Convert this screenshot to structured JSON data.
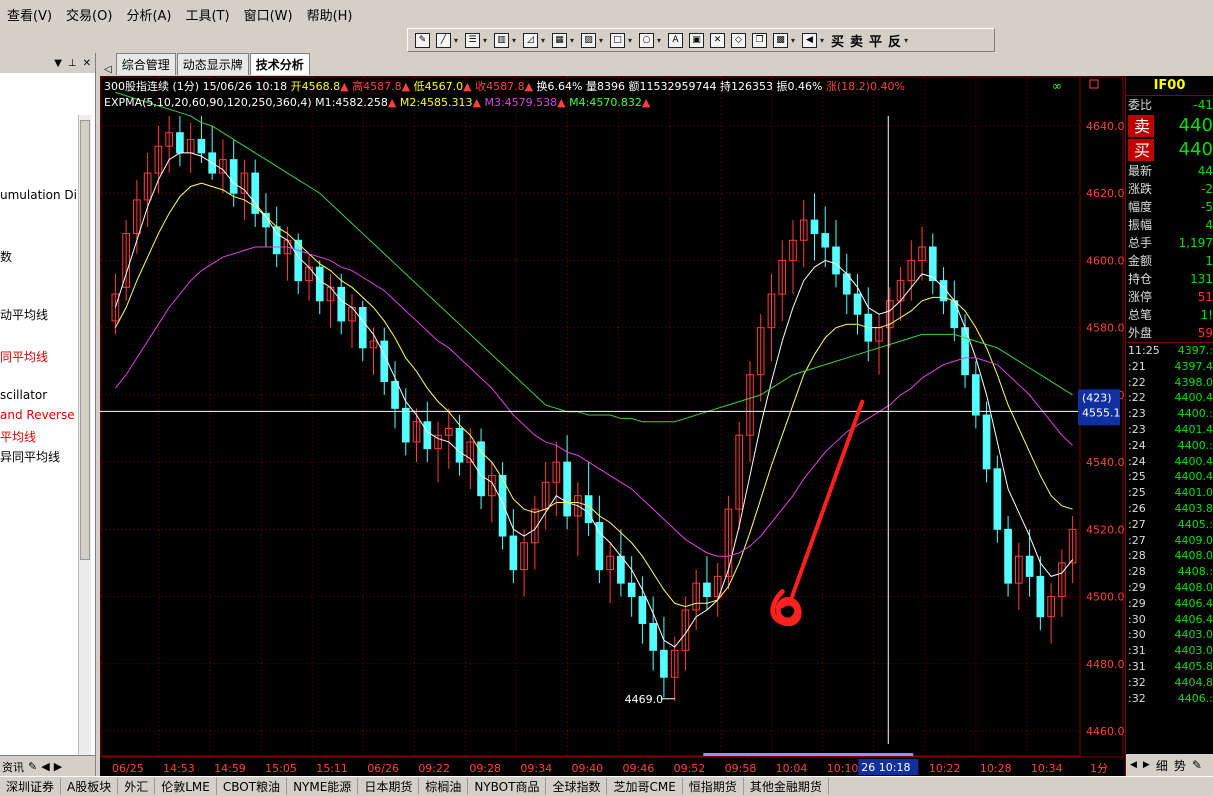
{
  "menu": [
    "查看(V)",
    "交易(O)",
    "分析(A)",
    "工具(T)",
    "窗口(W)",
    "帮助(H)"
  ],
  "toolbar": {
    "trade_buttons": [
      "买",
      "卖",
      "平",
      "反"
    ]
  },
  "left_panel": {
    "items": [
      {
        "label": "umulation Di",
        "color": "#000000"
      },
      {
        "label": "数",
        "color": "#000000"
      },
      {
        "label": "动平均线",
        "color": "#000000"
      },
      {
        "label": "同平均线",
        "color": "#e00000"
      },
      {
        "label": "scillator",
        "color": "#000000"
      },
      {
        "label": "and Reverse",
        "color": "#e00000"
      },
      {
        "label": "平均线",
        "color": "#e00000"
      },
      {
        "label": "异同平均线",
        "color": "#000000"
      }
    ],
    "footer": "资讯"
  },
  "tabs": [
    "综合管理",
    "动态显示牌",
    "技术分析"
  ],
  "chart": {
    "header": [
      {
        "text": "300股指连续 (1分)  15/06/26 10:18 ",
        "color": "#ffffff"
      },
      {
        "text": "开4568.8",
        "color": "#ffff00"
      },
      {
        "text": "▲ ",
        "color": "#ff4040"
      },
      {
        "text": "高4587.8",
        "color": "#ff4040"
      },
      {
        "text": "▲ ",
        "color": "#ff4040"
      },
      {
        "text": "低4567.0",
        "color": "#ffff00"
      },
      {
        "text": "▲ ",
        "color": "#ff4040"
      },
      {
        "text": "收4587.8",
        "color": "#ff4040"
      },
      {
        "text": "▲ ",
        "color": "#ff4040"
      },
      {
        "text": "换6.64% 量8396 额11532959744 持126353 振0.46% ",
        "color": "#ffffff"
      },
      {
        "text": "涨(18.2)0.40%",
        "color": "#ff4040"
      }
    ],
    "indicator": [
      {
        "text": "EXPMA(5,10,20,60,90,120,250,360,4) ",
        "color": "#ffffff"
      },
      {
        "text": "M1:4582.258",
        "color": "#ffffff"
      },
      {
        "text": "▲ ",
        "color": "#ff4040"
      },
      {
        "text": "M2:4585.313",
        "color": "#ffff00"
      },
      {
        "text": "▲ ",
        "color": "#ff4040"
      },
      {
        "text": "M3:4579.538",
        "color": "#e040e0"
      },
      {
        "text": "▲ ",
        "color": "#ff4040"
      },
      {
        "text": "M4:4570.832",
        "color": "#40ff40"
      },
      {
        "text": "▲",
        "color": "#ff4040"
      }
    ],
    "y_ticks": [
      "4640.0",
      "4620.0",
      "4600.0",
      "4580.0",
      "4560.0",
      "4540.0",
      "4520.0",
      "4500.0",
      "4480.0",
      "4460.0"
    ],
    "y_values": [
      4640,
      4620,
      4600,
      4580,
      4560,
      4540,
      4520,
      4500,
      4480,
      4460
    ],
    "x_labels": [
      "06/25",
      "14:53",
      "14:59",
      "15:05",
      "15:11",
      "06/26",
      "09:22",
      "09:28",
      "09:34",
      "09:40",
      "09:46",
      "09:52",
      "09:58",
      "10:04",
      "10:10",
      "10:16",
      "10:22",
      "10:28",
      "10:34"
    ],
    "crosshair_price": "4555.1",
    "crosshair_count": "(423)",
    "crosshair_time": "26 10:18",
    "low_label": "4469.0",
    "period_label": "1分"
  },
  "chart_data": {
    "type": "candlestick",
    "ylim": [
      4454,
      4644
    ],
    "grid": true,
    "ohlc": [
      [
        4582,
        4596,
        4578,
        4590
      ],
      [
        4592,
        4612,
        4588,
        4608
      ],
      [
        4608,
        4624,
        4602,
        4618
      ],
      [
        4618,
        4632,
        4610,
        4626
      ],
      [
        4626,
        4640,
        4620,
        4634
      ],
      [
        4634,
        4643,
        4626,
        4638
      ],
      [
        4638,
        4643,
        4628,
        4632
      ],
      [
        4632,
        4641,
        4626,
        4636
      ],
      [
        4636,
        4643,
        4629,
        4632
      ],
      [
        4632,
        4640,
        4624,
        4626
      ],
      [
        4626,
        4636,
        4620,
        4630
      ],
      [
        4630,
        4636,
        4616,
        4620
      ],
      [
        4620,
        4630,
        4612,
        4626
      ],
      [
        4626,
        4630,
        4610,
        4614
      ],
      [
        4614,
        4620,
        4604,
        4610
      ],
      [
        4610,
        4616,
        4598,
        4602
      ],
      [
        4602,
        4610,
        4594,
        4606
      ],
      [
        4606,
        4608,
        4590,
        4594
      ],
      [
        4594,
        4602,
        4588,
        4598
      ],
      [
        4598,
        4600,
        4584,
        4588
      ],
      [
        4588,
        4596,
        4580,
        4592
      ],
      [
        4592,
        4596,
        4578,
        4582
      ],
      [
        4582,
        4590,
        4574,
        4586
      ],
      [
        4586,
        4588,
        4570,
        4574
      ],
      [
        4574,
        4580,
        4566,
        4576
      ],
      [
        4576,
        4580,
        4560,
        4564
      ],
      [
        4564,
        4570,
        4550,
        4556
      ],
      [
        4556,
        4562,
        4542,
        4546
      ],
      [
        4546,
        4556,
        4540,
        4552
      ],
      [
        4552,
        4558,
        4540,
        4544
      ],
      [
        4544,
        4552,
        4534,
        4548
      ],
      [
        4548,
        4556,
        4538,
        4550
      ],
      [
        4550,
        4554,
        4536,
        4540
      ],
      [
        4540,
        4550,
        4532,
        4546
      ],
      [
        4546,
        4550,
        4526,
        4530
      ],
      [
        4530,
        4540,
        4522,
        4536
      ],
      [
        4536,
        4540,
        4514,
        4518
      ],
      [
        4518,
        4526,
        4504,
        4508
      ],
      [
        4508,
        4520,
        4500,
        4516
      ],
      [
        4516,
        4530,
        4508,
        4526
      ],
      [
        4526,
        4540,
        4520,
        4534
      ],
      [
        4534,
        4546,
        4524,
        4540
      ],
      [
        4540,
        4548,
        4520,
        4524
      ],
      [
        4524,
        4534,
        4512,
        4530
      ],
      [
        4530,
        4540,
        4518,
        4522
      ],
      [
        4522,
        4530,
        4504,
        4508
      ],
      [
        4508,
        4516,
        4498,
        4512
      ],
      [
        4512,
        4520,
        4500,
        4504
      ],
      [
        4504,
        4512,
        4494,
        4500
      ],
      [
        4500,
        4506,
        4486,
        4492
      ],
      [
        4492,
        4500,
        4478,
        4484
      ],
      [
        4484,
        4494,
        4470,
        4476
      ],
      [
        4476,
        4488,
        4469,
        4484
      ],
      [
        4484,
        4500,
        4478,
        4496
      ],
      [
        4496,
        4508,
        4490,
        4504
      ],
      [
        4504,
        4512,
        4496,
        4500
      ],
      [
        4500,
        4510,
        4494,
        4506
      ],
      [
        4506,
        4530,
        4502,
        4526
      ],
      [
        4526,
        4552,
        4520,
        4548
      ],
      [
        4548,
        4570,
        4540,
        4566
      ],
      [
        4566,
        4584,
        4558,
        4580
      ],
      [
        4580,
        4596,
        4570,
        4590
      ],
      [
        4590,
        4606,
        4582,
        4600
      ],
      [
        4600,
        4612,
        4590,
        4606
      ],
      [
        4606,
        4618,
        4598,
        4612
      ],
      [
        4612,
        4620,
        4600,
        4608
      ],
      [
        4608,
        4616,
        4598,
        4604
      ],
      [
        4604,
        4612,
        4592,
        4596
      ],
      [
        4596,
        4602,
        4584,
        4590
      ],
      [
        4590,
        4596,
        4578,
        4584
      ],
      [
        4584,
        4592,
        4570,
        4576
      ],
      [
        4576,
        4584,
        4566,
        4580
      ],
      [
        4580,
        4592,
        4574,
        4588
      ],
      [
        4588,
        4598,
        4582,
        4594
      ],
      [
        4594,
        4606,
        4588,
        4600
      ],
      [
        4600,
        4610,
        4594,
        4604
      ],
      [
        4604,
        4608,
        4590,
        4594
      ],
      [
        4594,
        4598,
        4584,
        4588
      ],
      [
        4588,
        4594,
        4576,
        4580
      ],
      [
        4580,
        4584,
        4562,
        4566
      ],
      [
        4566,
        4570,
        4550,
        4554
      ],
      [
        4554,
        4558,
        4534,
        4538
      ],
      [
        4538,
        4542,
        4516,
        4520
      ],
      [
        4520,
        4524,
        4500,
        4504
      ],
      [
        4504,
        4516,
        4496,
        4512
      ],
      [
        4512,
        4520,
        4500,
        4506
      ],
      [
        4506,
        4512,
        4490,
        4494
      ],
      [
        4494,
        4504,
        4486,
        4500
      ],
      [
        4500,
        4514,
        4494,
        4510
      ],
      [
        4510,
        4524,
        4504,
        4520
      ]
    ],
    "ema_fast": [
      4586,
      4596,
      4606,
      4616,
      4624,
      4630,
      4632,
      4632,
      4631,
      4629,
      4627,
      4623,
      4621,
      4617,
      4613,
      4608,
      4606,
      4601,
      4598,
      4594,
      4592,
      4588,
      4586,
      4582,
      4578,
      4572,
      4565,
      4558,
      4554,
      4549,
      4547,
      4546,
      4543,
      4541,
      4536,
      4534,
      4528,
      4520,
      4518,
      4520,
      4525,
      4530,
      4528,
      4527,
      4525,
      4519,
      4516,
      4512,
      4508,
      4502,
      4495,
      4487,
      4485,
      4489,
      4494,
      4496,
      4499,
      4508,
      4521,
      4536,
      4551,
      4564,
      4576,
      4586,
      4594,
      4598,
      4600,
      4599,
      4596,
      4592,
      4586,
      4584,
      4585,
      4588,
      4592,
      4596,
      4595,
      4592,
      4588,
      4580,
      4571,
      4560,
      4546,
      4532,
      4525,
      4518,
      4510,
      4506,
      4507,
      4511
    ],
    "ema_mid": [
      4580,
      4586,
      4594,
      4601,
      4608,
      4614,
      4619,
      4622,
      4623,
      4622,
      4621,
      4619,
      4618,
      4616,
      4613,
      4610,
      4608,
      4605,
      4602,
      4599,
      4597,
      4594,
      4592,
      4589,
      4586,
      4582,
      4577,
      4571,
      4567,
      4562,
      4558,
      4555,
      4551,
      4548,
      4543,
      4540,
      4535,
      4529,
      4526,
      4525,
      4526,
      4528,
      4528,
      4528,
      4527,
      4524,
      4522,
      4519,
      4516,
      4512,
      4507,
      4502,
      4498,
      4497,
      4498,
      4498,
      4499,
      4503,
      4510,
      4519,
      4529,
      4539,
      4548,
      4557,
      4566,
      4572,
      4577,
      4580,
      4581,
      4581,
      4580,
      4580,
      4581,
      4583,
      4585,
      4588,
      4589,
      4589,
      4588,
      4585,
      4580,
      4574,
      4566,
      4557,
      4550,
      4543,
      4536,
      4530,
      4527,
      4526
    ],
    "ema_slow": [
      4562,
      4566,
      4571,
      4576,
      4581,
      4586,
      4590,
      4594,
      4597,
      4599,
      4601,
      4602,
      4603,
      4604,
      4604,
      4604,
      4604,
      4603,
      4602,
      4601,
      4600,
      4598,
      4597,
      4595,
      4593,
      4591,
      4588,
      4585,
      4582,
      4579,
      4576,
      4574,
      4571,
      4568,
      4565,
      4562,
      4558,
      4554,
      4551,
      4548,
      4546,
      4545,
      4543,
      4542,
      4540,
      4538,
      4536,
      4534,
      4532,
      4529,
      4526,
      4523,
      4520,
      4517,
      4515,
      4513,
      4512,
      4512,
      4513,
      4515,
      4518,
      4522,
      4526,
      4530,
      4535,
      4539,
      4543,
      4546,
      4549,
      4551,
      4553,
      4555,
      4557,
      4560,
      4562,
      4565,
      4567,
      4569,
      4570,
      4571,
      4571,
      4570,
      4569,
      4566,
      4563,
      4560,
      4556,
      4552,
      4548,
      4545
    ],
    "ema_long": [
      4650,
      4649,
      4648,
      4647,
      4646,
      4645,
      4644,
      4643,
      4641,
      4640,
      4638,
      4636,
      4634,
      4632,
      4630,
      4628,
      4626,
      4624,
      4622,
      4620,
      4617,
      4614,
      4611,
      4608,
      4605,
      4602,
      4599,
      4596,
      4593,
      4590,
      4587,
      4584,
      4581,
      4578,
      4575,
      4572,
      4569,
      4566,
      4563,
      4560,
      4557,
      4556,
      4555,
      4555,
      4554,
      4554,
      4554,
      4553,
      4553,
      4552,
      4552,
      4552,
      4552,
      4553,
      4554,
      4555,
      4556,
      4557,
      4558,
      4559,
      4560,
      4562,
      4564,
      4566,
      4567,
      4568,
      4569,
      4570,
      4571,
      4572,
      4573,
      4574,
      4575,
      4576,
      4577,
      4578,
      4578,
      4578,
      4578,
      4577,
      4576,
      4575,
      4574,
      4572,
      4570,
      4568,
      4566,
      4564,
      4562,
      4560
    ]
  },
  "right_panel": {
    "code": "IF00",
    "weibi_label": "委比",
    "weibi_value": "-41",
    "sell_label": "卖",
    "sell_value": "440",
    "buy_label": "买",
    "buy_value": "440",
    "stats": [
      {
        "label": "最新",
        "value": "44"
      },
      {
        "label": "涨跌",
        "value": "-2"
      },
      {
        "label": "幅度",
        "value": "-5"
      },
      {
        "label": "振幅",
        "value": "4"
      },
      {
        "label": "总手",
        "value": "1,197"
      },
      {
        "label": "金额",
        "value": "1"
      },
      {
        "label": "持仓",
        "value": "131"
      },
      {
        "label": "涨停",
        "value": "51",
        "color": "#ff3030"
      },
      {
        "label": "总笔",
        "value": "1!"
      },
      {
        "label": "外盘",
        "value": "59",
        "color": "#ff3030"
      }
    ],
    "ticks": [
      {
        "time": "11:25",
        "price": "4397.:"
      },
      {
        "time": ":21",
        "price": "4397.4"
      },
      {
        "time": ":22",
        "price": "4398.0"
      },
      {
        "time": ":22",
        "price": "4400.4"
      },
      {
        "time": ":23",
        "price": "4400.:"
      },
      {
        "time": ":23",
        "price": "4401.4"
      },
      {
        "time": ":24",
        "price": "4400.:"
      },
      {
        "time": ":24",
        "price": "4400.4"
      },
      {
        "time": ":25",
        "price": "4400.4"
      },
      {
        "time": ":25",
        "price": "4401.0"
      },
      {
        "time": ":26",
        "price": "4403.8"
      },
      {
        "time": ":27",
        "price": "4405.:"
      },
      {
        "time": ":27",
        "price": "4409.0"
      },
      {
        "time": ":28",
        "price": "4408.0"
      },
      {
        "time": ":28",
        "price": "4408.:"
      },
      {
        "time": ":29",
        "price": "4408.0"
      },
      {
        "time": ":29",
        "price": "4406.4"
      },
      {
        "time": ":30",
        "price": "4406.4"
      },
      {
        "time": ":30",
        "price": "4403.0"
      },
      {
        "time": ":31",
        "price": "4403.0"
      },
      {
        "time": ":31",
        "price": "4405.8"
      },
      {
        "time": ":32",
        "price": "4404.8"
      },
      {
        "time": ":32",
        "price": "4406.:"
      }
    ],
    "tabs": [
      "细",
      "势"
    ]
  },
  "bottom_tabs": [
    "深圳证券",
    "A股板块",
    "外汇",
    "伦敦LME",
    "CBOT粮油",
    "NYME能源",
    "日本期货",
    "棕榈油",
    "NYBOT商品",
    "全球指数",
    "芝加哥CME",
    "恒指期货",
    "其他金融期货"
  ],
  "colors": {
    "up": "#ff3c3c",
    "down": "#54ffff",
    "ema_fast": "#ffffff",
    "ema_mid": "#ffff60",
    "ema_slow": "#e040e0",
    "ema_long": "#40d040",
    "grid": "#800000",
    "annotation": "#ff2020"
  }
}
